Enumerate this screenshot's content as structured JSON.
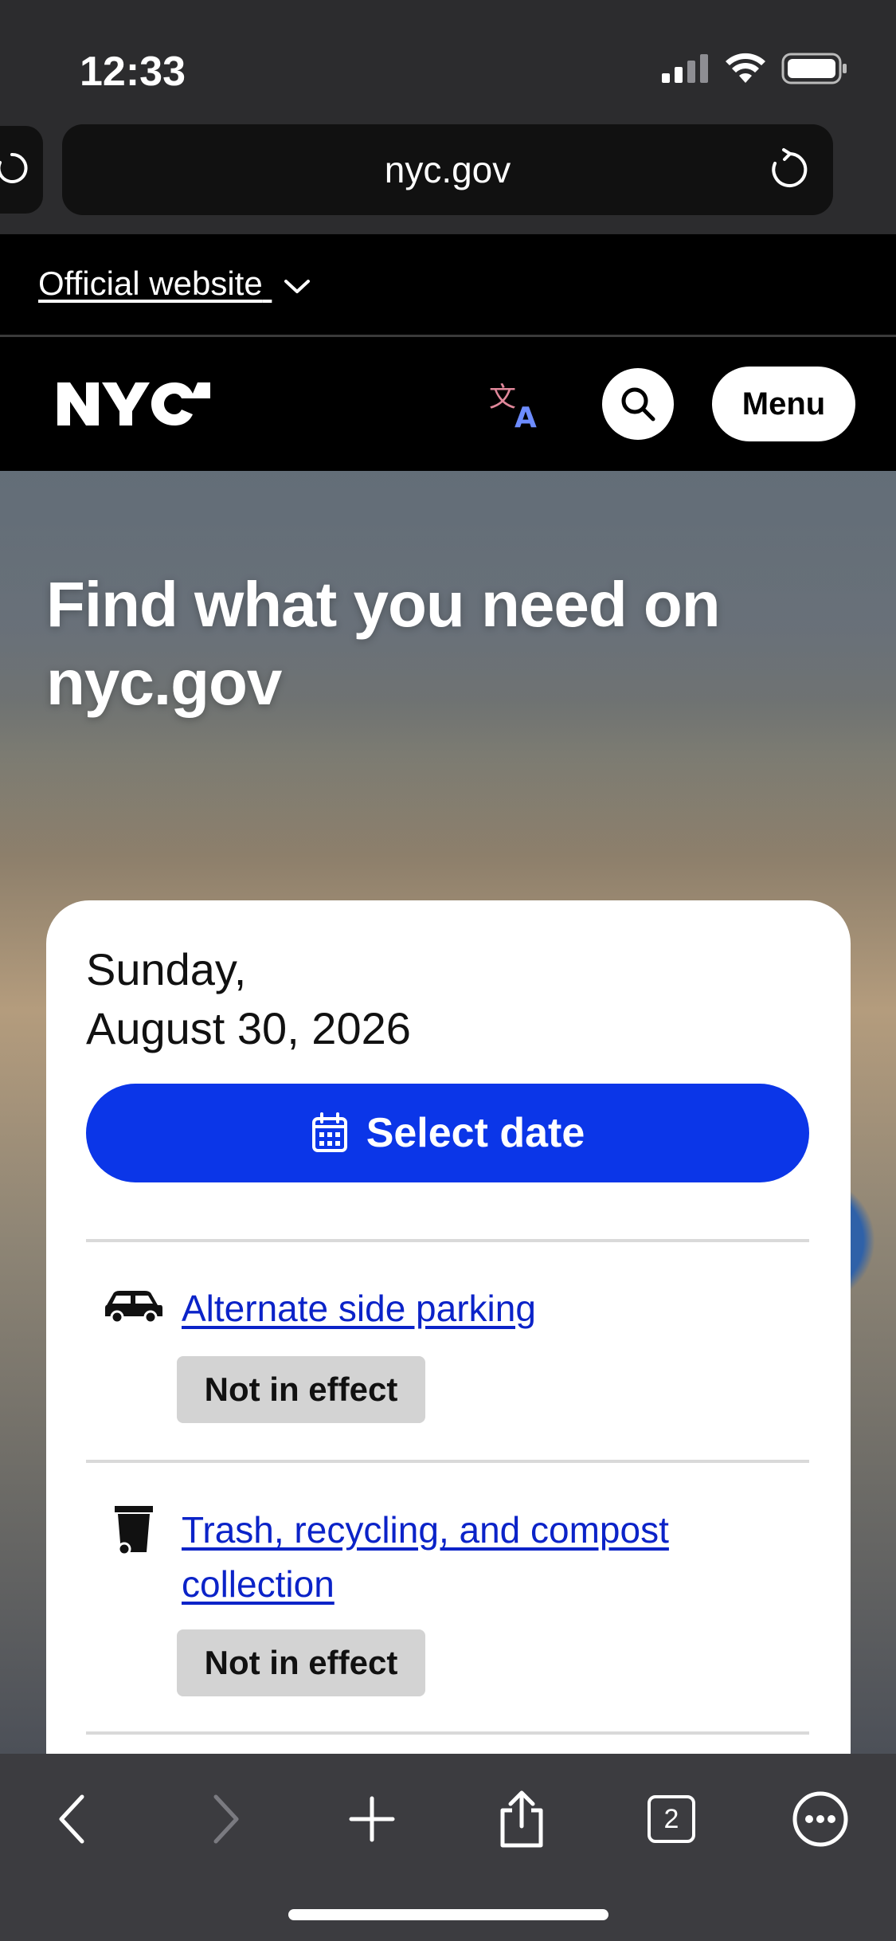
{
  "status_bar": {
    "time": "12:33"
  },
  "browser": {
    "url": "nyc.gov",
    "tab_count": "2"
  },
  "banner": {
    "official_label": "Official website"
  },
  "header": {
    "logo": "NYC",
    "menu_label": "Menu"
  },
  "hero": {
    "title": "Find what you need on nyc.gov"
  },
  "card": {
    "date_line1": "Sunday,",
    "date_line2": "August 30, 2026",
    "select_date_label": "Select date",
    "services": [
      {
        "icon": "car-icon",
        "label": "Alternate side parking",
        "status": "Not in effect"
      },
      {
        "icon": "trash-can-icon",
        "label": "Trash, recycling, and compost collection",
        "status": "Not in effect"
      }
    ]
  },
  "colors": {
    "accent_blue": "#0B36E8",
    "link_blue": "#0B23C8",
    "badge_gray": "#D3D3D3"
  }
}
